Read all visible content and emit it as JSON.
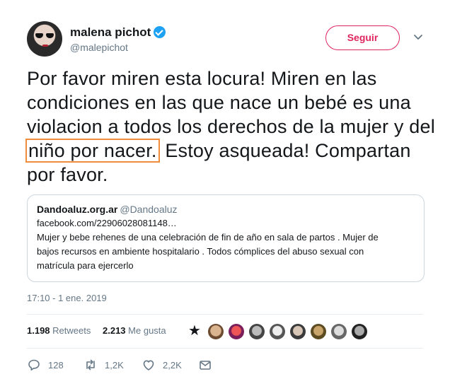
{
  "author": {
    "name": "malena pichot",
    "handle": "@malepichot",
    "verified": true
  },
  "follow_button": "Seguir",
  "tweet": {
    "text_before": "Por favor miren esta locura! Miren en las condiciones en las que nace un bebé es una violacion a todos los derechos de la mujer y del ",
    "text_highlight": "niño por nacer.",
    "text_after": " Estoy asqueada! Compartan por favor."
  },
  "quoted_tweet": {
    "name": "Dandoaluz.org.ar",
    "handle": "@Dandoaluz",
    "link": "facebook.com/22906028081148…",
    "lines": [
      "Mujer y bebe rehenes de una celebración de fin de año en sala de partos . Mujer de",
      "bajos recursos en ambiente hospitalario . Todos cómplices del abuso sexual con",
      "matrícula para ejercerlo"
    ]
  },
  "timestamp": "17:10 - 1 ene. 2019",
  "stats": {
    "retweets_count": "1.198",
    "retweets_label": "Retweets",
    "likes_count": "2.213",
    "likes_label": "Me gusta"
  },
  "actions": {
    "replies": "128",
    "retweets": "1,2K",
    "likes": "2,2K"
  },
  "colors": {
    "follow_accent": "#e0245e",
    "verified": "#1da1f2",
    "highlight_box": "#f08c3a",
    "muted_text": "#657786"
  },
  "icons": [
    "verified-badge-icon",
    "chevron-down-icon",
    "star-icon",
    "reply-icon",
    "retweet-icon",
    "heart-icon",
    "message-icon"
  ]
}
